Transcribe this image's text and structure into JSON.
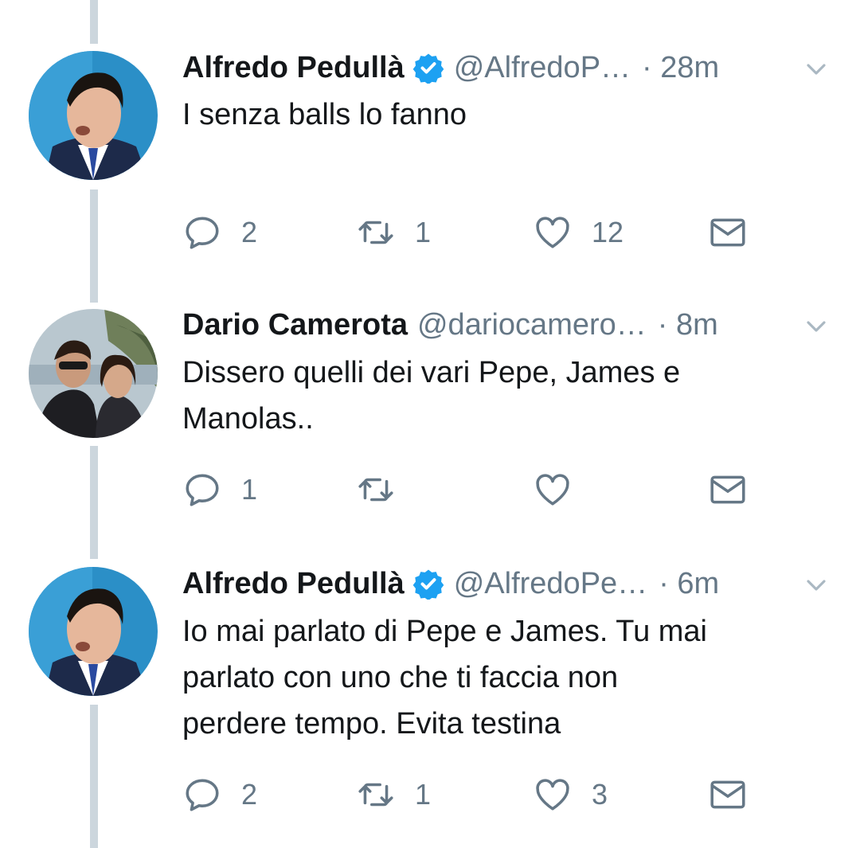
{
  "tweets": [
    {
      "name": "Alfredo Pedullà",
      "verified": true,
      "handle": "@AlfredoP…",
      "time": "· 28m",
      "text_lines": [
        "I senza balls lo fanno"
      ],
      "replies": "2",
      "retweets": "1",
      "likes": "12",
      "avatar": "man-in-suit-avatar"
    },
    {
      "name": "Dario Camerota",
      "verified": false,
      "handle": "@dariocamero…",
      "time": "· 8m",
      "text_lines": [
        "Dissero quelli dei vari Pepe, James e",
        "Manolas.."
      ],
      "replies": "1",
      "retweets": "",
      "likes": "",
      "avatar": "couple-outdoor-avatar"
    },
    {
      "name": "Alfredo Pedullà",
      "verified": true,
      "handle": "@AlfredoPe…",
      "time": "· 6m",
      "text_lines": [
        "Io mai parlato di Pepe e James. Tu mai",
        "parlato con uno che ti faccia non",
        "perdere tempo. Evita testina"
      ],
      "replies": "2",
      "retweets": "1",
      "likes": "3",
      "avatar": "man-in-suit-avatar"
    }
  ],
  "icons": {
    "reply": "reply-icon",
    "retweet": "retweet-icon",
    "like": "heart-icon",
    "dm": "envelope-icon",
    "verified": "verified-badge-icon",
    "more": "chevron-down-icon"
  },
  "colors": {
    "accent": "#1da1f2",
    "secondary_text": "#657786",
    "thread_line": "#ccd6dd"
  }
}
